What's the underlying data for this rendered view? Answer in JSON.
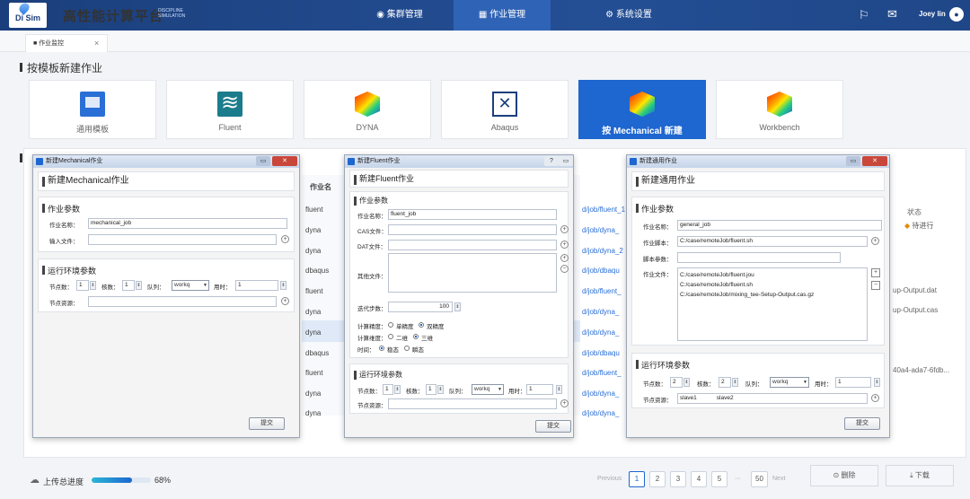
{
  "header": {
    "logo_text": "Di Sim",
    "title": "高性能计算平台",
    "subtitle": "DISCIPLINE SIMULATION",
    "nav": [
      {
        "icon": "cluster-icon",
        "label": "集群管理"
      },
      {
        "icon": "job-icon",
        "label": "作业管理"
      },
      {
        "icon": "gear-icon",
        "label": "系统设置"
      }
    ],
    "user": "Joey lin"
  },
  "tab": {
    "label": "作业监控",
    "close": "×"
  },
  "section_title": "按模板新建作业",
  "templates": [
    {
      "label": "通用模板"
    },
    {
      "label": "Fluent"
    },
    {
      "label": "DYNA"
    },
    {
      "label": "Abaqus"
    },
    {
      "label": "按 Mechanical 新建"
    },
    {
      "label": "Workbench"
    }
  ],
  "list": {
    "col_header": "作业名",
    "rows": [
      "fluent",
      "dyna",
      "dyna",
      "dbaqus",
      "fluent",
      "dyna",
      "dyna",
      "dbaqus",
      "fluent",
      "dyna",
      "dyna"
    ],
    "paths": [
      "d/job/fluent_1",
      "d/job/dyna_",
      "d/job/dyna_2",
      "d/job/dbaqu",
      "d/job/fluent_",
      "d/job/dyna_",
      "d/job/dyna_",
      "d/job/dbaqu",
      "d/job/fluent_",
      "d/job/dyna_",
      "d/job/dyna_"
    ],
    "status_header": "状态",
    "status_value": "待进行",
    "right_texts": [
      "up-Output.dat",
      "up-Output.cas",
      "40a4-ada7-6fdb..."
    ]
  },
  "footer": {
    "progress_label": "上传总进度",
    "progress": 0.68,
    "progress_text": "68%",
    "pagination": {
      "prev": "Previous",
      "pages": [
        "1",
        "2",
        "3",
        "4",
        "5"
      ],
      "ellipsis": "···",
      "last": "50",
      "next": "Next",
      "current": "1"
    },
    "delete_label": "删除",
    "download_label": "下载"
  },
  "dlg_mech": {
    "window_title": "新建Mechanical作业",
    "heading": "新建Mechanical作业",
    "params_title": "作业参数",
    "name_label": "作业名称：",
    "name_value": "mechanical_job",
    "input_label": "输入文件：",
    "env_title": "运行环境参数",
    "nodes_label": "节点数：",
    "nodes_value": "1",
    "cores_label": "核数：",
    "cores_value": "1",
    "queue_label": "队列：",
    "queue_value": "workq",
    "time_label": "用时：",
    "time_value": "1",
    "res_label": "节点资源：",
    "submit": "提交"
  },
  "dlg_fluent": {
    "window_title": "新建Fluent作业",
    "heading": "新建Fluent作业",
    "params_title": "作业参数",
    "name_label": "作业名称：",
    "name_value": "fluent_job",
    "cas_label": "CAS文件：",
    "dat_label": "DAT文件：",
    "other_label": "其他文件：",
    "iter_label": "迭代步数：",
    "iter_value": "100",
    "prec_label": "计算精度：",
    "prec_opts": [
      "单精度",
      "双精度"
    ],
    "dim_label": "计算维度：",
    "dim_opts": [
      "二维",
      "三维"
    ],
    "time_label": "时间：",
    "time_opts": [
      "稳态",
      "瞬态"
    ],
    "env_title": "运行环境参数",
    "nodes_label": "节点数：",
    "nodes_value": "1",
    "cores_label": "核数：",
    "cores_value": "1",
    "queue_label": "队列：",
    "queue_value": "workq",
    "usetime_label": "用时：",
    "usetime_value": "1",
    "res_label": "节点资源：",
    "submit": "提交"
  },
  "dlg_general": {
    "window_title": "新建通用作业",
    "heading": "新建通用作业",
    "params_title": "作业参数",
    "name_label": "作业名称：",
    "name_value": "general_job",
    "script_label": "作业脚本：",
    "script_value": "C:/case/remoteJob/fluent.sh",
    "args_label": "脚本参数：",
    "files_label": "作业文件：",
    "files": [
      "C:/case/remoteJob/fluent.jou",
      "C:/case/remoteJob/fluent.sh",
      "C:/case/remoteJob/mixing_tee-Setup-Output.cas.gz"
    ],
    "env_title": "运行环境参数",
    "nodes_label": "节点数：",
    "nodes_value": "2",
    "cores_label": "核数：",
    "cores_value": "2",
    "queue_label": "队列：",
    "queue_value": "workq",
    "time_label": "用时：",
    "time_value": "1",
    "res_label": "节点资源：",
    "res_value_1": "slave1",
    "res_value_2": "slave2",
    "submit": "提交"
  }
}
